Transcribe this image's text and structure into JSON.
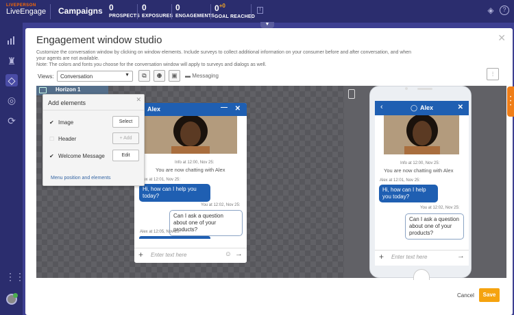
{
  "topbar": {
    "logo_top": "LIVEPERSON",
    "logo_bottom": "LiveEngage",
    "campaigns": "Campaigns",
    "stats": [
      {
        "value": "0",
        "label": "PROSPECTS"
      },
      {
        "value": "0",
        "label": "EXPOSURES"
      },
      {
        "value": "0",
        "label": "ENGAGEMENTS"
      },
      {
        "value": "0",
        "extra": "+0",
        "label": "GOAL REACHED"
      }
    ]
  },
  "modal": {
    "title": "Engagement window studio",
    "description": "Customize the conversation window by clicking on window elements. Include surveys to collect additional information on your consumer before and after conversation, and when your agents are not available.",
    "note": "Note: The colors and fonts you choose for the conversation window will apply to surveys and dialogs as well.",
    "views_label": "Views:",
    "views_value": "Conversation",
    "messaging": "Messaging",
    "tab": "Horizon 1",
    "cancel": "Cancel",
    "save": "Save"
  },
  "add_elements": {
    "title": "Add elements",
    "items": [
      {
        "label": "Image",
        "checked": true,
        "button": "Select"
      },
      {
        "label": "Header",
        "checked": false,
        "button": "+ Add"
      },
      {
        "label": "Welcome Message",
        "checked": true,
        "button": "Edit"
      }
    ],
    "link": "Menu position and elements"
  },
  "chat": {
    "agent": "Alex",
    "info": "Info at 12:00, Nov 25:",
    "status": "You are now chatting with Alex",
    "agent_meta": "Alex at 12:01, Nov 25:",
    "agent_msg": "Hi, how can I help you today?",
    "you_meta": "You at 12:02, Nov 25:",
    "you_msg": "Can I ask a question about one of your products?",
    "agent_meta2": "Alex at 12:05, Nov 25:",
    "placeholder": "Enter text here"
  },
  "colors": {
    "brand": "#2b2d6e",
    "chat_header": "#1f5fb2",
    "save": "#f5a30f"
  }
}
